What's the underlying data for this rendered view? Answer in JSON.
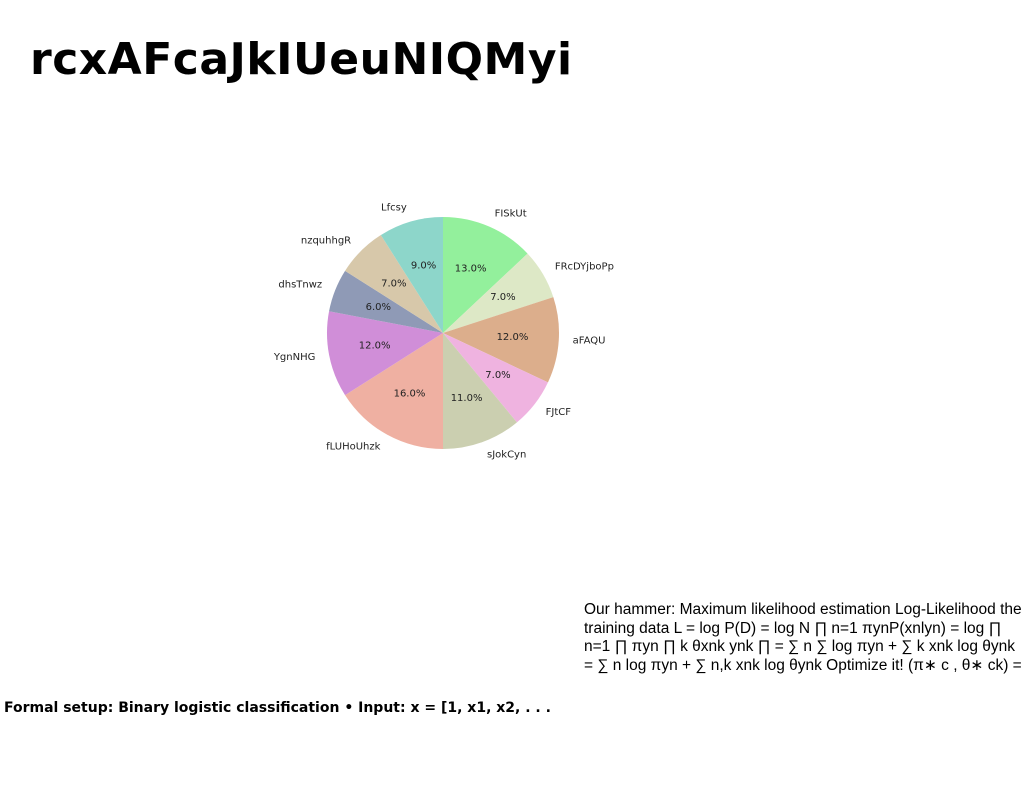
{
  "title": "rcxAFcaJkIUeuNIQMyi",
  "side_note": "Our hammer: Maximum likelihood estimation Log-Likelihood the training data L = log P(D) = log N ∏ n=1 πynP(xnlyn) = log ∏ n=1 ∏ πyn ∏ k θxnk ynk ∏ = ∑ n ∑ log πyn + ∑ k xnk log θynk = ∑ n log πyn + ∑ n,k xnk log θynk Optimize it! (π∗ c , θ∗ ck) =",
  "footer_note": "Formal setup: Binary logistic classification • Input: x = [1, x1, x2, . . .",
  "chart_data": {
    "type": "pie",
    "start_angle_deg": 90,
    "direction": "clockwise",
    "slices": [
      {
        "label": "FISkUt",
        "value": 13.0,
        "pct_label": "13.0%",
        "color": "#93f09c"
      },
      {
        "label": "FRcDYjboPp",
        "value": 7.0,
        "pct_label": "7.0%",
        "color": "#dde8c6"
      },
      {
        "label": "aFAQU",
        "value": 12.0,
        "pct_label": "12.0%",
        "color": "#dcae8c"
      },
      {
        "label": "FJtCF",
        "value": 7.0,
        "pct_label": "7.0%",
        "color": "#efb3e0"
      },
      {
        "label": "sJokCyn",
        "value": 11.0,
        "pct_label": "11.0%",
        "color": "#cbcfb0"
      },
      {
        "label": "fLUHoUhzk",
        "value": 16.0,
        "pct_label": "16.0%",
        "color": "#efb0a2"
      },
      {
        "label": "YgnNHG",
        "value": 12.0,
        "pct_label": "12.0%",
        "color": "#d08ed8"
      },
      {
        "label": "dhsTnwz",
        "value": 6.0,
        "pct_label": "6.0%",
        "color": "#8f9ab6"
      },
      {
        "label": "nzquhhgR",
        "value": 7.0,
        "pct_label": "7.0%",
        "color": "#d7c8aa"
      },
      {
        "label": "Lfcsy",
        "value": 9.0,
        "pct_label": "9.0%",
        "color": "#8dd6ca"
      }
    ]
  }
}
